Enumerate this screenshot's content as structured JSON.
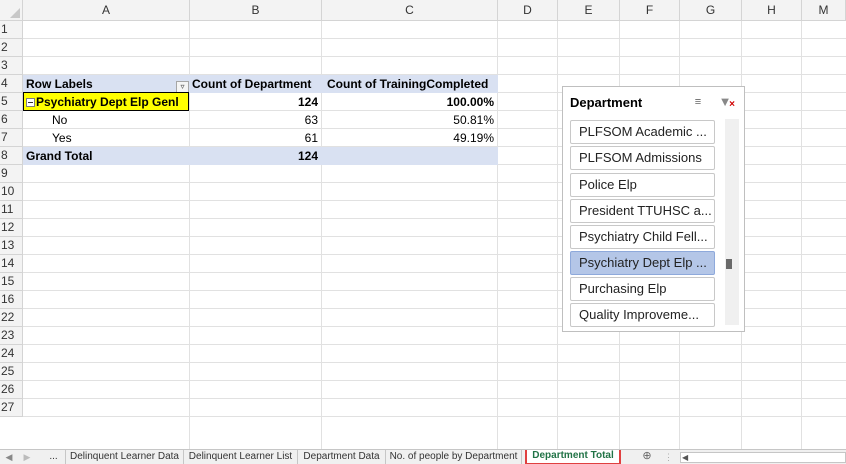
{
  "columns": [
    "A",
    "B",
    "C",
    "D",
    "E",
    "F",
    "G",
    "H",
    "M"
  ],
  "rows": [
    "1",
    "2",
    "3",
    "4",
    "5",
    "6",
    "7",
    "8",
    "9",
    "10",
    "11",
    "12",
    "13",
    "14",
    "15",
    "16",
    "22",
    "23",
    "24",
    "25",
    "26",
    "27"
  ],
  "pivot": {
    "header": {
      "row_labels": "Row Labels",
      "col_b": "Count of Department",
      "col_c": "Count of TrainingCompleted"
    },
    "group": {
      "label": "Psychiatry Dept Elp Genl",
      "count": "124",
      "pct": "100.00%"
    },
    "items": [
      {
        "label": "No",
        "count": "63",
        "pct": "50.81%"
      },
      {
        "label": "Yes",
        "count": "61",
        "pct": "49.19%"
      }
    ],
    "grand_total": {
      "label": "Grand Total",
      "count": "124"
    }
  },
  "slicer": {
    "title": "Department",
    "multiselect_icon": "multi-select-icon",
    "clear_icon": "clear-filter-icon",
    "items": [
      {
        "label": "PLFSOM Academic ...",
        "selected": false
      },
      {
        "label": "PLFSOM Admissions",
        "selected": false
      },
      {
        "label": "Police Elp",
        "selected": false
      },
      {
        "label": "President TTUHSC a...",
        "selected": false
      },
      {
        "label": "Psychiatry Child Fell...",
        "selected": false
      },
      {
        "label": "Psychiatry Dept Elp ...",
        "selected": true
      },
      {
        "label": "Purchasing Elp",
        "selected": false
      },
      {
        "label": "Quality Improveme...",
        "selected": false
      }
    ]
  },
  "sheet_tabs": {
    "ellipsis": "...",
    "tabs": [
      {
        "label": "Delinquent Learner Data",
        "active": false
      },
      {
        "label": "Delinquent Learner List",
        "active": false
      },
      {
        "label": "Department Data",
        "active": false
      },
      {
        "label": "No. of people by Department",
        "active": false
      },
      {
        "label": "Department Total",
        "active": true
      }
    ],
    "add_label": "⊕"
  },
  "colors": {
    "pivot_band": "#d9e1f2",
    "selected_cell": "#ffff00",
    "slicer_selected": "#b4c6e7",
    "active_tab_text": "#217346",
    "active_tab_border": "#e04040"
  }
}
